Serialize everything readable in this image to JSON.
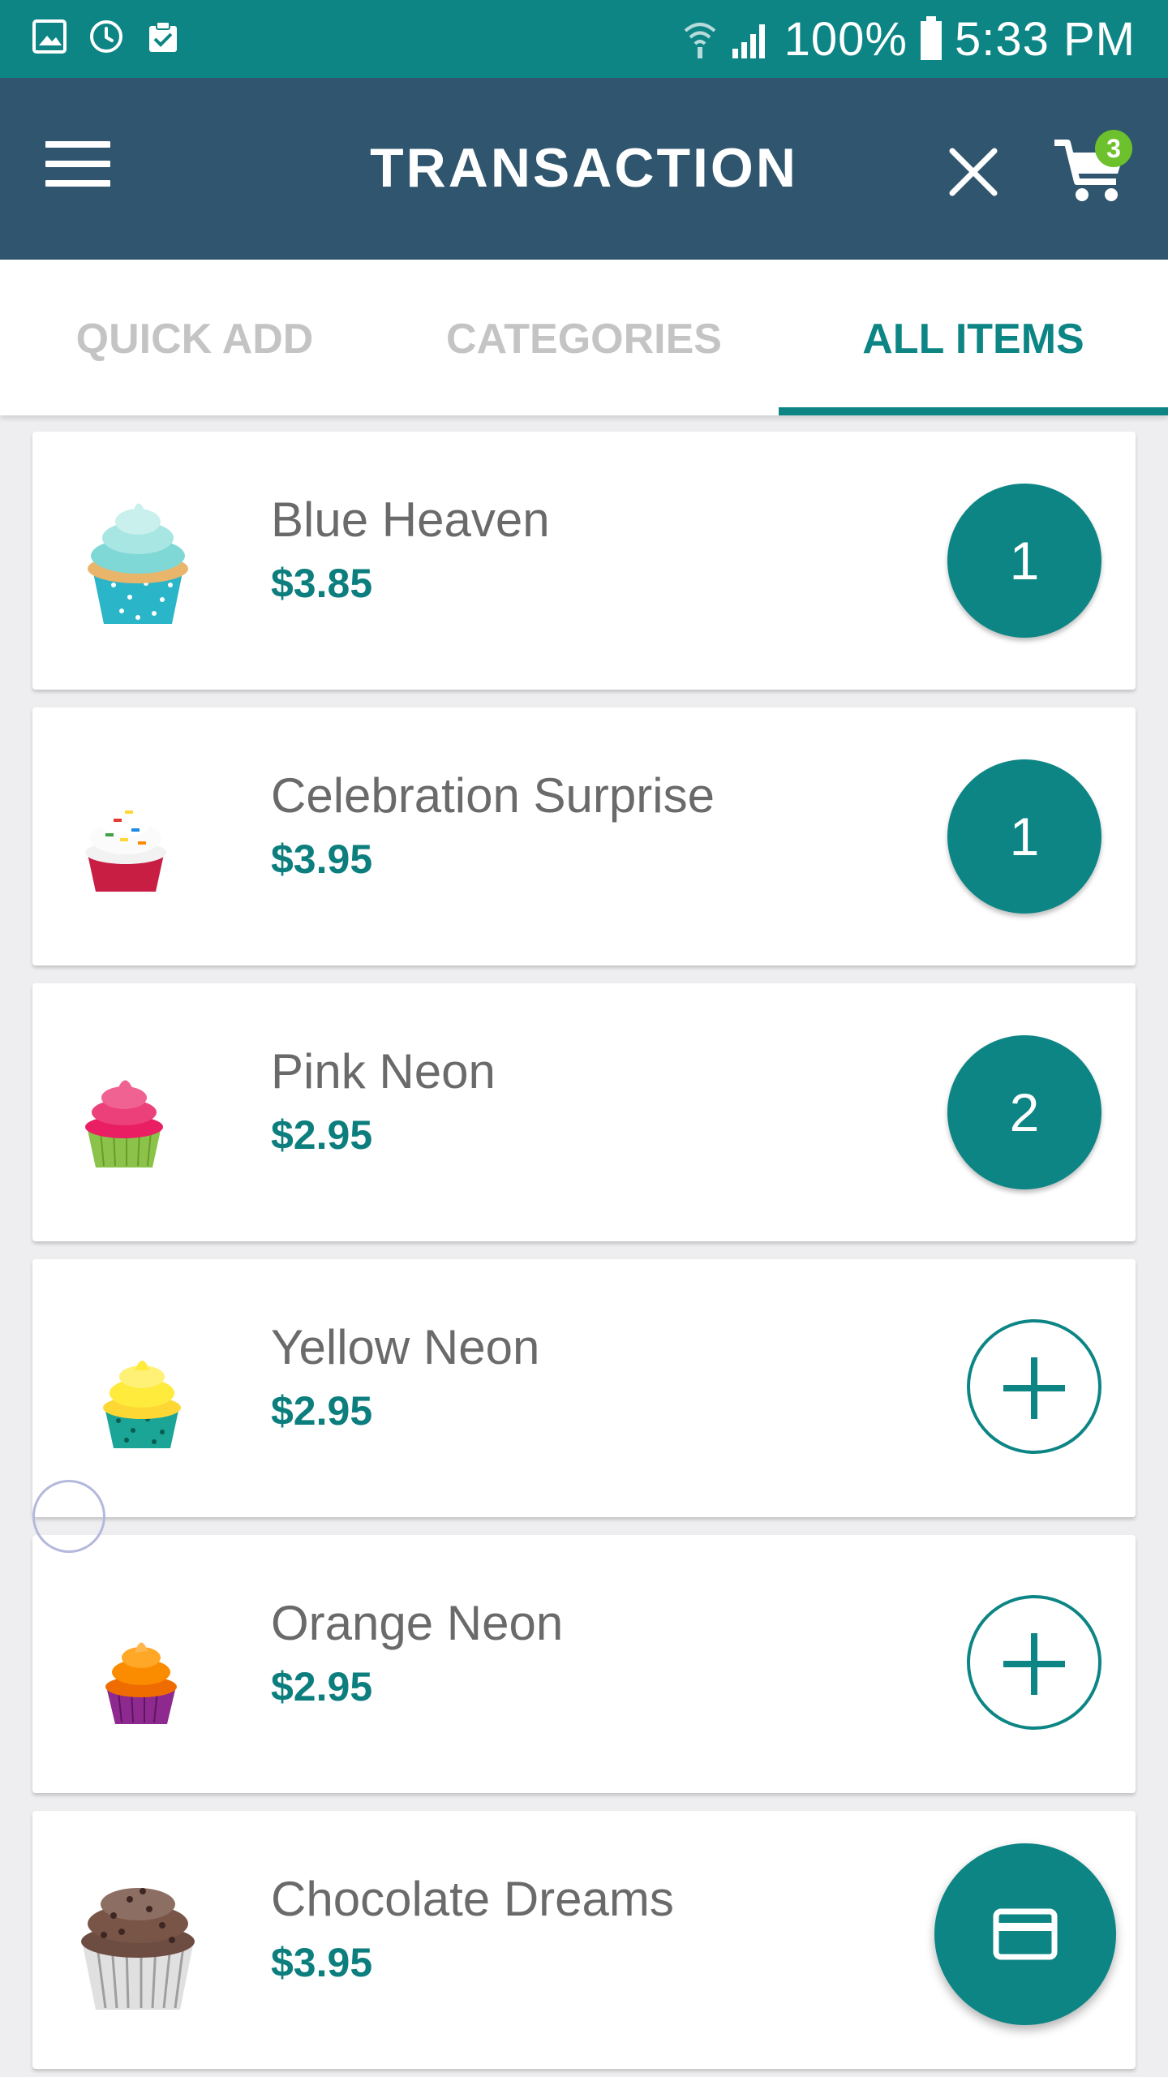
{
  "status_bar": {
    "battery": "100%",
    "time": "5:33 PM",
    "icons": [
      "gallery-icon",
      "sync-icon",
      "clipboard-check-icon",
      "wifi-icon",
      "signal-icon",
      "battery-icon"
    ]
  },
  "app_bar": {
    "title": "TRANSACTION",
    "cart_count": "3",
    "icons": [
      "menu-icon",
      "close-icon",
      "cart-icon"
    ]
  },
  "tabs": [
    {
      "label": "QUICK ADD",
      "active": false
    },
    {
      "label": "CATEGORIES",
      "active": false
    },
    {
      "label": "ALL ITEMS",
      "active": true
    }
  ],
  "items": [
    {
      "name": "Blue Heaven",
      "price": "$3.85",
      "qty": "1"
    },
    {
      "name": "Celebration Surprise",
      "price": "$3.95",
      "qty": "1"
    },
    {
      "name": "Pink Neon",
      "price": "$2.95",
      "qty": "2"
    },
    {
      "name": "Yellow Neon",
      "price": "$2.95",
      "qty": null
    },
    {
      "name": "Orange Neon",
      "price": "$2.95",
      "qty": null
    },
    {
      "name": "Chocolate Dreams",
      "price": "$3.95",
      "qty": null
    }
  ],
  "fab": {
    "icon": "credit-card-icon"
  },
  "colors": {
    "status_bar": "#0d8585",
    "app_bar": "#2f566e",
    "accent": "#0d8585",
    "badge": "#6cc12c",
    "background": "#eeeef0"
  }
}
